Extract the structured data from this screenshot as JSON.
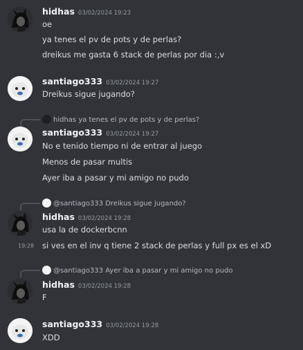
{
  "messages": [
    {
      "author": "hidhas",
      "timestamp": "03/02/2024 19:23",
      "lines": [
        "oe",
        "ya tenes el pv de pots y de perlas?",
        "dreikus me gasta 6 stack de perlas por dia :,v"
      ]
    },
    {
      "author": "santiago333",
      "timestamp": "03/02/2024 19:27",
      "lines": [
        "Dreikus sigue jugando?"
      ]
    },
    {
      "reply_to": "hidhas ya tenes el pv de pots y de perlas?",
      "author": "santiago333",
      "timestamp": "03/02/2024 19:27",
      "lines": [
        "No e tenido tiempo ni de entrar al juego",
        "Menos de pasar multis",
        "Ayer iba a pasar y mi amigo no pudo"
      ]
    },
    {
      "reply_to": "@santiago333 Dreikus sigue jugando?",
      "author": "hidhas",
      "timestamp": "03/02/2024 19:28",
      "lines": [
        "usa la de dockerbcnn",
        "si ves en el inv q tiene 2 stack de perlas y full px es el xD"
      ],
      "side_timestamp": "19:28"
    },
    {
      "reply_to": "@santiago333 Ayer iba a pasar y mi amigo no pudo",
      "author": "hidhas",
      "timestamp": "03/02/2024 19:28",
      "lines": [
        "F"
      ]
    },
    {
      "author": "santiago333",
      "timestamp": "03/02/2024 19:28",
      "lines": [
        "XDD"
      ]
    }
  ],
  "colors": {
    "background": "#313338",
    "text": "#dbdee1",
    "username": "#f2f3f5",
    "timestamp": "#949ba4"
  },
  "icons": {
    "hidhas_avatar": "dark-character-avatar-icon",
    "santiago333_avatar": "white-creature-avatar-icon"
  }
}
